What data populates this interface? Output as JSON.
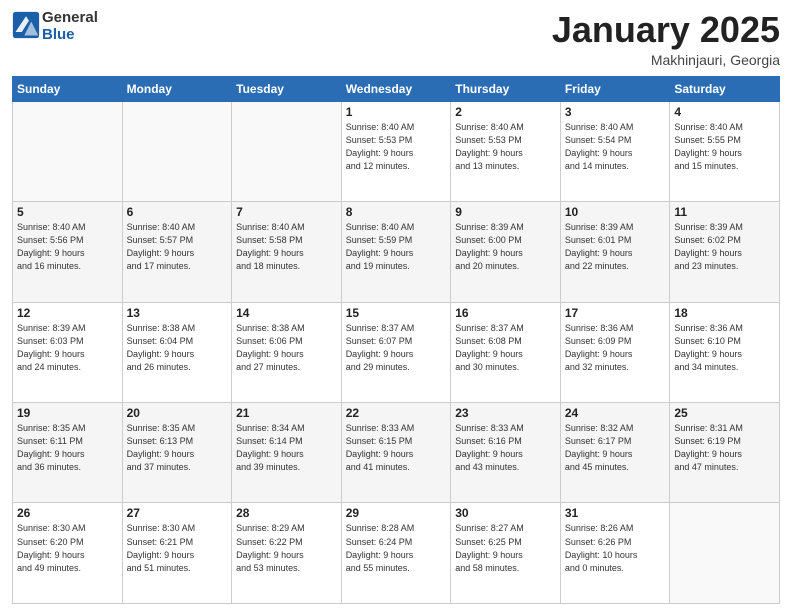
{
  "header": {
    "logo": {
      "general": "General",
      "blue": "Blue"
    },
    "title": "January 2025",
    "location": "Makhinjauri, Georgia"
  },
  "weekdays": [
    "Sunday",
    "Monday",
    "Tuesday",
    "Wednesday",
    "Thursday",
    "Friday",
    "Saturday"
  ],
  "weeks": [
    [
      {
        "day": "",
        "sunrise": "",
        "sunset": "",
        "daylight": ""
      },
      {
        "day": "",
        "sunrise": "",
        "sunset": "",
        "daylight": ""
      },
      {
        "day": "",
        "sunrise": "",
        "sunset": "",
        "daylight": ""
      },
      {
        "day": "1",
        "sunrise": "Sunrise: 8:40 AM",
        "sunset": "Sunset: 5:53 PM",
        "daylight": "Daylight: 9 hours and 12 minutes."
      },
      {
        "day": "2",
        "sunrise": "Sunrise: 8:40 AM",
        "sunset": "Sunset: 5:53 PM",
        "daylight": "Daylight: 9 hours and 13 minutes."
      },
      {
        "day": "3",
        "sunrise": "Sunrise: 8:40 AM",
        "sunset": "Sunset: 5:54 PM",
        "daylight": "Daylight: 9 hours and 14 minutes."
      },
      {
        "day": "4",
        "sunrise": "Sunrise: 8:40 AM",
        "sunset": "Sunset: 5:55 PM",
        "daylight": "Daylight: 9 hours and 15 minutes."
      }
    ],
    [
      {
        "day": "5",
        "sunrise": "Sunrise: 8:40 AM",
        "sunset": "Sunset: 5:56 PM",
        "daylight": "Daylight: 9 hours and 16 minutes."
      },
      {
        "day": "6",
        "sunrise": "Sunrise: 8:40 AM",
        "sunset": "Sunset: 5:57 PM",
        "daylight": "Daylight: 9 hours and 17 minutes."
      },
      {
        "day": "7",
        "sunrise": "Sunrise: 8:40 AM",
        "sunset": "Sunset: 5:58 PM",
        "daylight": "Daylight: 9 hours and 18 minutes."
      },
      {
        "day": "8",
        "sunrise": "Sunrise: 8:40 AM",
        "sunset": "Sunset: 5:59 PM",
        "daylight": "Daylight: 9 hours and 19 minutes."
      },
      {
        "day": "9",
        "sunrise": "Sunrise: 8:39 AM",
        "sunset": "Sunset: 6:00 PM",
        "daylight": "Daylight: 9 hours and 20 minutes."
      },
      {
        "day": "10",
        "sunrise": "Sunrise: 8:39 AM",
        "sunset": "Sunset: 6:01 PM",
        "daylight": "Daylight: 9 hours and 22 minutes."
      },
      {
        "day": "11",
        "sunrise": "Sunrise: 8:39 AM",
        "sunset": "Sunset: 6:02 PM",
        "daylight": "Daylight: 9 hours and 23 minutes."
      }
    ],
    [
      {
        "day": "12",
        "sunrise": "Sunrise: 8:39 AM",
        "sunset": "Sunset: 6:03 PM",
        "daylight": "Daylight: 9 hours and 24 minutes."
      },
      {
        "day": "13",
        "sunrise": "Sunrise: 8:38 AM",
        "sunset": "Sunset: 6:04 PM",
        "daylight": "Daylight: 9 hours and 26 minutes."
      },
      {
        "day": "14",
        "sunrise": "Sunrise: 8:38 AM",
        "sunset": "Sunset: 6:06 PM",
        "daylight": "Daylight: 9 hours and 27 minutes."
      },
      {
        "day": "15",
        "sunrise": "Sunrise: 8:37 AM",
        "sunset": "Sunset: 6:07 PM",
        "daylight": "Daylight: 9 hours and 29 minutes."
      },
      {
        "day": "16",
        "sunrise": "Sunrise: 8:37 AM",
        "sunset": "Sunset: 6:08 PM",
        "daylight": "Daylight: 9 hours and 30 minutes."
      },
      {
        "day": "17",
        "sunrise": "Sunrise: 8:36 AM",
        "sunset": "Sunset: 6:09 PM",
        "daylight": "Daylight: 9 hours and 32 minutes."
      },
      {
        "day": "18",
        "sunrise": "Sunrise: 8:36 AM",
        "sunset": "Sunset: 6:10 PM",
        "daylight": "Daylight: 9 hours and 34 minutes."
      }
    ],
    [
      {
        "day": "19",
        "sunrise": "Sunrise: 8:35 AM",
        "sunset": "Sunset: 6:11 PM",
        "daylight": "Daylight: 9 hours and 36 minutes."
      },
      {
        "day": "20",
        "sunrise": "Sunrise: 8:35 AM",
        "sunset": "Sunset: 6:13 PM",
        "daylight": "Daylight: 9 hours and 37 minutes."
      },
      {
        "day": "21",
        "sunrise": "Sunrise: 8:34 AM",
        "sunset": "Sunset: 6:14 PM",
        "daylight": "Daylight: 9 hours and 39 minutes."
      },
      {
        "day": "22",
        "sunrise": "Sunrise: 8:33 AM",
        "sunset": "Sunset: 6:15 PM",
        "daylight": "Daylight: 9 hours and 41 minutes."
      },
      {
        "day": "23",
        "sunrise": "Sunrise: 8:33 AM",
        "sunset": "Sunset: 6:16 PM",
        "daylight": "Daylight: 9 hours and 43 minutes."
      },
      {
        "day": "24",
        "sunrise": "Sunrise: 8:32 AM",
        "sunset": "Sunset: 6:17 PM",
        "daylight": "Daylight: 9 hours and 45 minutes."
      },
      {
        "day": "25",
        "sunrise": "Sunrise: 8:31 AM",
        "sunset": "Sunset: 6:19 PM",
        "daylight": "Daylight: 9 hours and 47 minutes."
      }
    ],
    [
      {
        "day": "26",
        "sunrise": "Sunrise: 8:30 AM",
        "sunset": "Sunset: 6:20 PM",
        "daylight": "Daylight: 9 hours and 49 minutes."
      },
      {
        "day": "27",
        "sunrise": "Sunrise: 8:30 AM",
        "sunset": "Sunset: 6:21 PM",
        "daylight": "Daylight: 9 hours and 51 minutes."
      },
      {
        "day": "28",
        "sunrise": "Sunrise: 8:29 AM",
        "sunset": "Sunset: 6:22 PM",
        "daylight": "Daylight: 9 hours and 53 minutes."
      },
      {
        "day": "29",
        "sunrise": "Sunrise: 8:28 AM",
        "sunset": "Sunset: 6:24 PM",
        "daylight": "Daylight: 9 hours and 55 minutes."
      },
      {
        "day": "30",
        "sunrise": "Sunrise: 8:27 AM",
        "sunset": "Sunset: 6:25 PM",
        "daylight": "Daylight: 9 hours and 58 minutes."
      },
      {
        "day": "31",
        "sunrise": "Sunrise: 8:26 AM",
        "sunset": "Sunset: 6:26 PM",
        "daylight": "Daylight: 10 hours and 0 minutes."
      },
      {
        "day": "",
        "sunrise": "",
        "sunset": "",
        "daylight": ""
      }
    ]
  ]
}
